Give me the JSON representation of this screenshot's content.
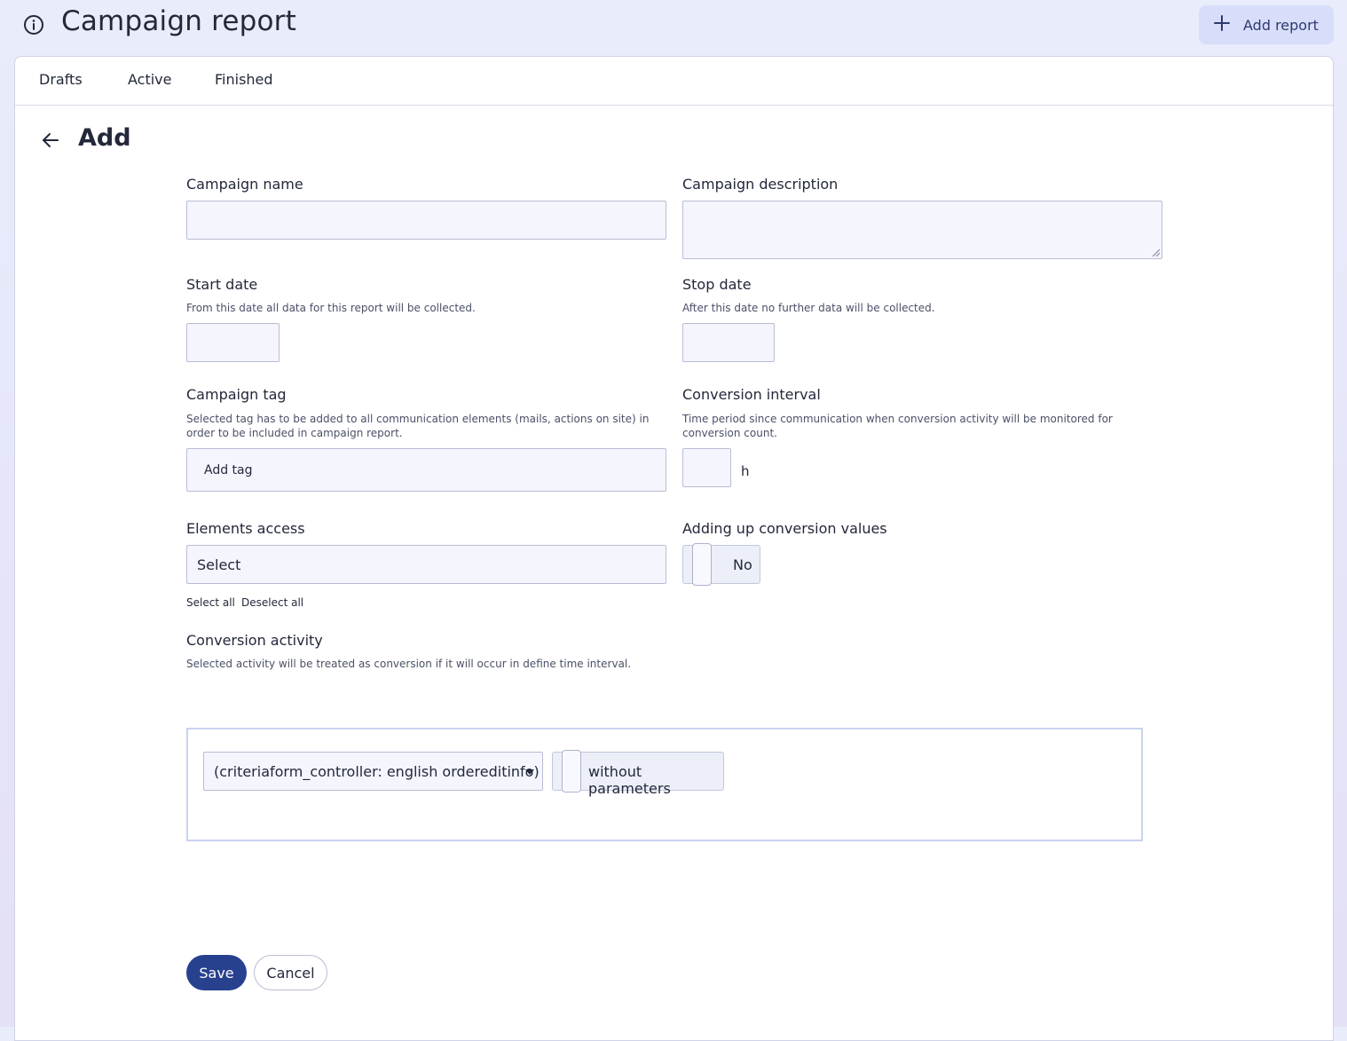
{
  "header": {
    "title": "Campaign report",
    "add_report_label": "Add report"
  },
  "tabs": [
    {
      "label": "Drafts"
    },
    {
      "label": "Active"
    },
    {
      "label": "Finished"
    }
  ],
  "form": {
    "title": "Add",
    "campaign_name": {
      "label": "Campaign name",
      "value": ""
    },
    "campaign_description": {
      "label": "Campaign description",
      "value": ""
    },
    "start_date": {
      "label": "Start date",
      "hint": "From this date all data for this report will be collected.",
      "value": ""
    },
    "stop_date": {
      "label": "Stop date",
      "hint": "After this date no further data will be collected.",
      "value": ""
    },
    "campaign_tag": {
      "label": "Campaign tag",
      "hint": "Selected tag has to be added to all communication elements (mails, actions on site) in order to be included in campaign report.",
      "placeholder": "Add tag"
    },
    "conversion_interval": {
      "label": "Conversion interval",
      "hint": "Time period since communication when conversion activity will be monitored for conversion count.",
      "value": "",
      "unit": "h"
    },
    "elements_access": {
      "label": "Elements access",
      "selected": "Select",
      "select_all": "Select all",
      "deselect_all": "Deselect all"
    },
    "adding_up": {
      "label": "Adding up conversion values",
      "state": "No"
    },
    "conversion_activity": {
      "label": "Conversion activity",
      "hint": "Selected activity will be treated as conversion if it will occur in define time interval.",
      "selected": "(criteriaform_controller: english ordereditinfo)",
      "params_toggle_label": "without parameters"
    }
  },
  "actions": {
    "save_label": "Save",
    "cancel_label": "Cancel"
  },
  "colors": {
    "primary": "#27418f",
    "accent_bg": "#d8defa",
    "input_bg": "#f4f5fd"
  }
}
